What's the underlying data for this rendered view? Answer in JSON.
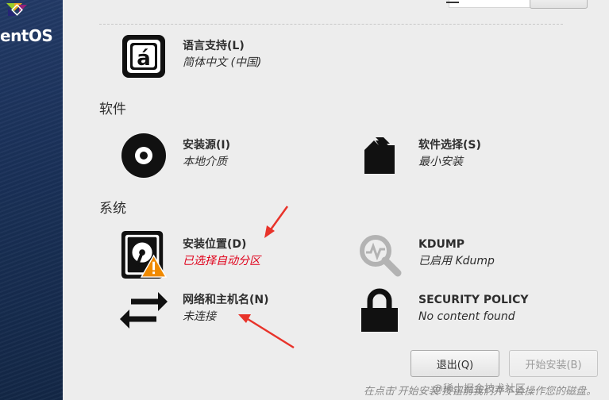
{
  "sidebar": {
    "logo_text": "entOS"
  },
  "sections": {
    "localization_partial": {
      "language": {
        "title": "语言支持(L)",
        "status": "简体中文 (中国)"
      }
    },
    "software": {
      "title": "软件",
      "install_source": {
        "title": "安装源(I)",
        "status": "本地介质"
      },
      "software_selection": {
        "title": "软件选择(S)",
        "status": "最小安装"
      }
    },
    "system": {
      "title": "系统",
      "install_destination": {
        "title": "安装位置(D)",
        "status": "已选择自动分区"
      },
      "kdump": {
        "title": "KDUMP",
        "status": "已启用 Kdump"
      },
      "network": {
        "title": "网络和主机名(N)",
        "status": "未连接"
      },
      "security_policy": {
        "title": "SECURITY POLICY",
        "status": "No content found"
      }
    }
  },
  "buttons": {
    "quit": "退出(Q)",
    "begin_install": "开始安装(B)"
  },
  "footer_note": "在点击'开始安装'按钮前我们并不会操作您的磁盘。",
  "watermark": "@稀土掘金技术社区",
  "colors": {
    "warning_text": "#e0001a",
    "annotation_arrow": "#e8332a",
    "sidebar": "#1a3159"
  }
}
